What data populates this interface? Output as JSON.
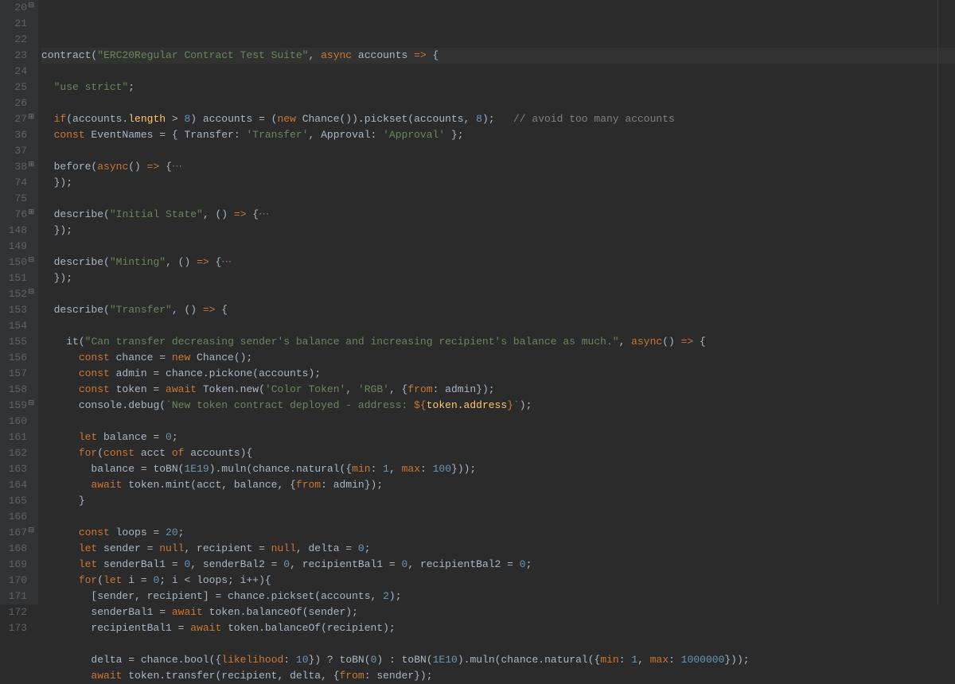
{
  "lines": [
    {
      "num": 20,
      "fold": "●",
      "tokens": [
        [
          "call",
          "contract"
        ],
        [
          "p",
          "("
        ],
        [
          "str",
          "\"ERC20Regular Contract Test Suite\""
        ],
        [
          "p",
          ", "
        ],
        [
          "kw",
          "async"
        ],
        [
          "p",
          " accounts "
        ],
        [
          "arrow",
          "=>"
        ],
        [
          "p",
          " {"
        ]
      ]
    },
    {
      "num": 21,
      "tokens": []
    },
    {
      "num": 22,
      "indent": 1,
      "tokens": [
        [
          "str",
          "\"use strict\""
        ],
        [
          "p",
          ";"
        ]
      ]
    },
    {
      "num": 23,
      "tokens": []
    },
    {
      "num": 24,
      "indent": 1,
      "tokens": [
        [
          "kw",
          "if"
        ],
        [
          "p",
          "(accounts."
        ],
        [
          "prop",
          "length"
        ],
        [
          "p",
          " > "
        ],
        [
          "num",
          "8"
        ],
        [
          "p",
          ") accounts = ("
        ],
        [
          "kw",
          "new"
        ],
        [
          "p",
          " Chance())."
        ],
        [
          "call",
          "pickset"
        ],
        [
          "p",
          "(accounts, "
        ],
        [
          "num",
          "8"
        ],
        [
          "p",
          ");   "
        ],
        [
          "cmnt",
          "// avoid too many accounts"
        ]
      ]
    },
    {
      "num": 25,
      "indent": 1,
      "tokens": [
        [
          "kw",
          "const"
        ],
        [
          "p",
          " EventNames = { Transfer: "
        ],
        [
          "str",
          "'Transfer'"
        ],
        [
          "p",
          ", Approval: "
        ],
        [
          "str",
          "'Approval'"
        ],
        [
          "p",
          " };"
        ]
      ]
    },
    {
      "num": 26,
      "tokens": []
    },
    {
      "num": 27,
      "fold": "⊕",
      "indent": 1,
      "tokens": [
        [
          "call",
          "before"
        ],
        [
          "p",
          "("
        ],
        [
          "kw",
          "async"
        ],
        [
          "p",
          "() "
        ],
        [
          "arrow",
          "=>"
        ],
        [
          "p",
          " {"
        ],
        [
          "fold",
          "⋯"
        ]
      ]
    },
    {
      "num": 36,
      "indent": 1,
      "tokens": [
        [
          "p",
          "});"
        ]
      ]
    },
    {
      "num": 37,
      "tokens": []
    },
    {
      "num": 38,
      "fold": "⊕",
      "indent": 1,
      "tokens": [
        [
          "call",
          "describe"
        ],
        [
          "p",
          "("
        ],
        [
          "str",
          "\"Initial State\""
        ],
        [
          "p",
          ", () "
        ],
        [
          "arrow",
          "=>"
        ],
        [
          "p",
          " {"
        ],
        [
          "fold",
          "⋯"
        ]
      ]
    },
    {
      "num": 74,
      "indent": 1,
      "tokens": [
        [
          "p",
          "});"
        ]
      ]
    },
    {
      "num": 75,
      "tokens": []
    },
    {
      "num": 76,
      "fold": "⊕",
      "indent": 1,
      "tokens": [
        [
          "call",
          "describe"
        ],
        [
          "p",
          "("
        ],
        [
          "str",
          "\"Minting\""
        ],
        [
          "p",
          ", () "
        ],
        [
          "arrow",
          "=>"
        ],
        [
          "p",
          " {"
        ],
        [
          "fold",
          "⋯"
        ]
      ]
    },
    {
      "num": 148,
      "indent": 1,
      "tokens": [
        [
          "p",
          "});"
        ]
      ]
    },
    {
      "num": 149,
      "tokens": []
    },
    {
      "num": 150,
      "fold": "●",
      "indent": 1,
      "tokens": [
        [
          "call",
          "describe"
        ],
        [
          "p",
          "("
        ],
        [
          "str",
          "\"Transfer\""
        ],
        [
          "p",
          ", () "
        ],
        [
          "arrow",
          "=>"
        ],
        [
          "p",
          " {"
        ]
      ]
    },
    {
      "num": 151,
      "tokens": []
    },
    {
      "num": 152,
      "fold": "●",
      "indent": 2,
      "tokens": [
        [
          "call",
          "it"
        ],
        [
          "p",
          "("
        ],
        [
          "str",
          "\"Can transfer decreasing sender's balance and increasing recipient's balance as much.\""
        ],
        [
          "p",
          ", "
        ],
        [
          "kw",
          "async"
        ],
        [
          "p",
          "() "
        ],
        [
          "arrow",
          "=>"
        ],
        [
          "p",
          " {"
        ]
      ]
    },
    {
      "num": 153,
      "indent": 3,
      "tokens": [
        [
          "kw",
          "const"
        ],
        [
          "p",
          " chance = "
        ],
        [
          "kw",
          "new"
        ],
        [
          "p",
          " Chance();"
        ]
      ]
    },
    {
      "num": 154,
      "indent": 3,
      "tokens": [
        [
          "kw",
          "const"
        ],
        [
          "p",
          " admin = chance."
        ],
        [
          "call",
          "pickone"
        ],
        [
          "p",
          "(accounts);"
        ]
      ]
    },
    {
      "num": 155,
      "indent": 3,
      "tokens": [
        [
          "kw",
          "const"
        ],
        [
          "p",
          " token = "
        ],
        [
          "kw",
          "await"
        ],
        [
          "p",
          " Token."
        ],
        [
          "call",
          "new"
        ],
        [
          "p",
          "("
        ],
        [
          "str",
          "'Color Token'"
        ],
        [
          "p",
          ", "
        ],
        [
          "str",
          "'RGB'"
        ],
        [
          "p",
          ", {"
        ],
        [
          "kw",
          "from"
        ],
        [
          "p",
          ": admin});"
        ]
      ]
    },
    {
      "num": 156,
      "indent": 3,
      "tokens": [
        [
          "p",
          "console."
        ],
        [
          "call",
          "debug"
        ],
        [
          "p",
          "("
        ],
        [
          "str",
          "`New token contract deployed - address: "
        ],
        [
          "tmpl",
          "${"
        ],
        [
          "prop",
          "token.address"
        ],
        [
          "tmpl",
          "}"
        ],
        [
          "str",
          "`"
        ],
        [
          "p",
          ");"
        ]
      ]
    },
    {
      "num": 157,
      "tokens": []
    },
    {
      "num": 158,
      "indent": 3,
      "tokens": [
        [
          "kw",
          "let"
        ],
        [
          "p",
          " balance = "
        ],
        [
          "num",
          "0"
        ],
        [
          "p",
          ";"
        ]
      ]
    },
    {
      "num": 159,
      "fold": "●",
      "indent": 3,
      "tokens": [
        [
          "kw",
          "for"
        ],
        [
          "p",
          "("
        ],
        [
          "kw",
          "const"
        ],
        [
          "p",
          " acct "
        ],
        [
          "kw",
          "of"
        ],
        [
          "p",
          " accounts){"
        ]
      ]
    },
    {
      "num": 160,
      "indent": 4,
      "tokens": [
        [
          "p",
          "balance = "
        ],
        [
          "call",
          "toBN"
        ],
        [
          "p",
          "("
        ],
        [
          "num",
          "1E19"
        ],
        [
          "p",
          ")."
        ],
        [
          "call",
          "muln"
        ],
        [
          "p",
          "(chance."
        ],
        [
          "call",
          "natural"
        ],
        [
          "p",
          "({"
        ],
        [
          "kw",
          "min"
        ],
        [
          "p",
          ": "
        ],
        [
          "num",
          "1"
        ],
        [
          "p",
          ", "
        ],
        [
          "kw",
          "max"
        ],
        [
          "p",
          ": "
        ],
        [
          "num",
          "100"
        ],
        [
          "p",
          "}));"
        ]
      ]
    },
    {
      "num": 161,
      "indent": 4,
      "tokens": [
        [
          "kw",
          "await"
        ],
        [
          "p",
          " token."
        ],
        [
          "call",
          "mint"
        ],
        [
          "p",
          "(acct, balance, {"
        ],
        [
          "kw",
          "from"
        ],
        [
          "p",
          ": admin});"
        ]
      ]
    },
    {
      "num": 162,
      "indent": 3,
      "tokens": [
        [
          "p",
          "}"
        ]
      ]
    },
    {
      "num": 163,
      "tokens": []
    },
    {
      "num": 164,
      "indent": 3,
      "tokens": [
        [
          "kw",
          "const"
        ],
        [
          "p",
          " loops = "
        ],
        [
          "num",
          "20"
        ],
        [
          "p",
          ";"
        ]
      ]
    },
    {
      "num": 165,
      "indent": 3,
      "tokens": [
        [
          "kw",
          "let"
        ],
        [
          "p",
          " sender = "
        ],
        [
          "kw",
          "null"
        ],
        [
          "p",
          ", recipient = "
        ],
        [
          "kw",
          "null"
        ],
        [
          "p",
          ", delta = "
        ],
        [
          "num",
          "0"
        ],
        [
          "p",
          ";"
        ]
      ]
    },
    {
      "num": 166,
      "indent": 3,
      "tokens": [
        [
          "kw",
          "let"
        ],
        [
          "p",
          " senderBal1 = "
        ],
        [
          "num",
          "0"
        ],
        [
          "p",
          ", senderBal2 = "
        ],
        [
          "num",
          "0"
        ],
        [
          "p",
          ", recipientBal1 = "
        ],
        [
          "num",
          "0"
        ],
        [
          "p",
          ", recipientBal2 = "
        ],
        [
          "num",
          "0"
        ],
        [
          "p",
          ";"
        ]
      ]
    },
    {
      "num": 167,
      "fold": "●",
      "indent": 3,
      "tokens": [
        [
          "kw",
          "for"
        ],
        [
          "p",
          "("
        ],
        [
          "kw",
          "let"
        ],
        [
          "p",
          " i = "
        ],
        [
          "num",
          "0"
        ],
        [
          "p",
          "; i < loops; i++){"
        ]
      ]
    },
    {
      "num": 168,
      "indent": 4,
      "tokens": [
        [
          "p",
          "[sender, recipient] = chance."
        ],
        [
          "call",
          "pickset"
        ],
        [
          "p",
          "(accounts, "
        ],
        [
          "num",
          "2"
        ],
        [
          "p",
          ");"
        ]
      ]
    },
    {
      "num": 169,
      "indent": 4,
      "tokens": [
        [
          "p",
          "senderBal1 = "
        ],
        [
          "kw",
          "await"
        ],
        [
          "p",
          " token."
        ],
        [
          "call",
          "balanceOf"
        ],
        [
          "p",
          "(sender);"
        ]
      ]
    },
    {
      "num": 170,
      "indent": 4,
      "tokens": [
        [
          "p",
          "recipientBal1 = "
        ],
        [
          "kw",
          "await"
        ],
        [
          "p",
          " token."
        ],
        [
          "call",
          "balanceOf"
        ],
        [
          "p",
          "(recipient);"
        ]
      ]
    },
    {
      "num": 171,
      "tokens": []
    },
    {
      "num": 172,
      "indent": 4,
      "tokens": [
        [
          "p",
          "delta = chance."
        ],
        [
          "call",
          "bool"
        ],
        [
          "p",
          "({"
        ],
        [
          "kw",
          "likelihood"
        ],
        [
          "p",
          ": "
        ],
        [
          "num",
          "10"
        ],
        [
          "p",
          "}) ? "
        ],
        [
          "call",
          "toBN"
        ],
        [
          "p",
          "("
        ],
        [
          "num",
          "0"
        ],
        [
          "p",
          ") : "
        ],
        [
          "call",
          "toBN"
        ],
        [
          "p",
          "("
        ],
        [
          "num",
          "1E10"
        ],
        [
          "p",
          ")."
        ],
        [
          "call",
          "muln"
        ],
        [
          "p",
          "(chance."
        ],
        [
          "call",
          "natural"
        ],
        [
          "p",
          "({"
        ],
        [
          "kw",
          "min"
        ],
        [
          "p",
          ": "
        ],
        [
          "num",
          "1"
        ],
        [
          "p",
          ", "
        ],
        [
          "kw",
          "max"
        ],
        [
          "p",
          ": "
        ],
        [
          "num",
          "1000000"
        ],
        [
          "p",
          "}));"
        ]
      ]
    },
    {
      "num": 173,
      "indent": 4,
      "tokens": [
        [
          "kw",
          "await"
        ],
        [
          "p",
          " token."
        ],
        [
          "call",
          "transfer"
        ],
        [
          "p",
          "(recipient, delta, {"
        ],
        [
          "kw",
          "from"
        ],
        [
          "p",
          ": sender});"
        ]
      ]
    }
  ]
}
